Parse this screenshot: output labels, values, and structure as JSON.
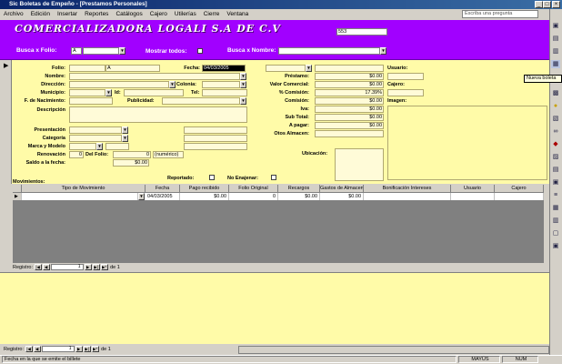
{
  "window": {
    "title": "Sic Boletas de Empeño - [Prestamos Personales]",
    "min_label": "_",
    "max_label": "□",
    "close_label": "×"
  },
  "menu": {
    "items": [
      "Archivo",
      "Edición",
      "Insertar",
      "Reportes",
      "Catálogos",
      "Cajero",
      "Utilerías",
      "Cierre",
      "Ventana"
    ],
    "help_placeholder": "Escriba una pregunta"
  },
  "header": {
    "company": "COMERCIALIZADORA LOGALI S.A DE C.V",
    "record_number": "553",
    "busca_folio_label": "Busca x Folio:",
    "busca_folio_value": "A",
    "mostrar_todos_label": "Mostrar todos:",
    "busca_nombre_label": "Busca x Nombre:",
    "busca_nombre_value": ""
  },
  "form": {
    "folio_label": "Folio:",
    "folio_value": "A",
    "fecha_label": "Fecha:",
    "fecha_value": "04/03/2005",
    "nombre_label": "Nombre:",
    "direccion_label": "Dirección:",
    "colonia_label": "Colonia:",
    "municipio_label": "Municipio:",
    "id_label": "Id:",
    "tel_label": "Tel:",
    "nacimiento_label": "F. de Nacimiento:",
    "publicidad_label": "Publicidad:",
    "descripcion_label": "Descripción",
    "presentacion_label": "Presentación",
    "categoria_label": "Categoría",
    "marca_label": "Marca y Modelo",
    "renovacion_label": "Renovación",
    "renovacion_value": "0",
    "del_folio_label": "Del Folio:",
    "del_folio_value": "0",
    "numerico_value": "(numérico)",
    "saldo_label": "Saldo a la fecha:",
    "saldo_value": "$0.00",
    "prestamo_label": "Préstamo:",
    "prestamo_value": "$0.00",
    "valor_label": "Valor Comercial:",
    "valor_value": "$0.00",
    "comision_pct_label": "% Comisión:",
    "comision_pct_value": "17.39%",
    "comision_label": "Comisión:",
    "comision_value": "$0.00",
    "iva_label": "Iva:",
    "iva_value": "$0.00",
    "subtotal_label": "Sub Total:",
    "subtotal_value": "$0.00",
    "apagar_label": "A pagar:",
    "apagar_value": "$0.00",
    "otros_label": "Otos Almacen:",
    "ubicacion_label": "Ubicación:",
    "usuario_label": "Usuario:",
    "cajero_label": "Cajero:",
    "imagen_label": "Imagen:",
    "reportado_label": "Reportado:",
    "noenajenar_label": "No Enajenar:",
    "movimientos_label": "Movimientos:"
  },
  "grid": {
    "columns": [
      "Tipo de Movimiento",
      "Fecha",
      "Pago recibido",
      "Folio Original",
      "Recargos",
      "Gastos de Almacen",
      "Bonificación Intereses",
      "Usuario",
      "Cajero"
    ],
    "row": [
      "",
      "04/03/2005",
      "$0.00",
      "0",
      "$0.00",
      "$0.00",
      "",
      "",
      ""
    ]
  },
  "subnav": {
    "label": "Registro:",
    "current": "1",
    "of_label": "de 1"
  },
  "mainnav": {
    "label": "Registro:",
    "current": "1",
    "of_label": "de 1"
  },
  "tooltip": "Nueva boleta",
  "status": {
    "message": "Fecha en la que se emite el billete",
    "mayus": "MAYÚS",
    "num": "NUM"
  },
  "toolbar_icons": [
    "new-record-icon",
    "save-icon",
    "print-icon",
    "search-icon",
    "binoculars-icon",
    "filter-icon",
    "sort-icon",
    "delete-icon",
    "report-icon",
    "close-icon"
  ]
}
